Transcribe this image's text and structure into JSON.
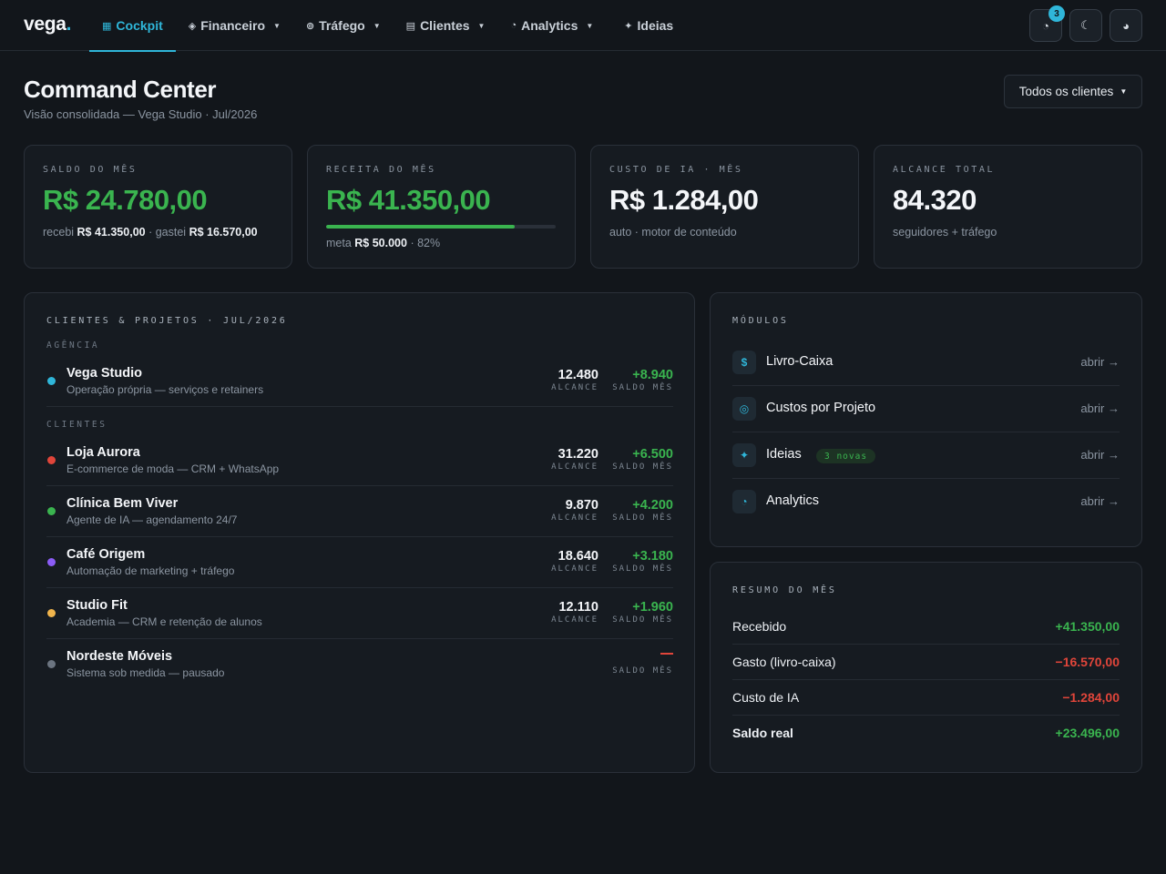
{
  "brand": {
    "name": "vega",
    "dot": "."
  },
  "nav": [
    {
      "icon": "▦",
      "label": "Cockpit",
      "caret": "",
      "active": true
    },
    {
      "icon": "◈",
      "label": "Financeiro",
      "caret": "▼"
    },
    {
      "icon": "⊚",
      "label": "Tráfego",
      "caret": "▼"
    },
    {
      "icon": "▤",
      "label": "Clientes",
      "caret": "▼"
    },
    {
      "icon": "◔",
      "label": "Analytics",
      "caret": "▼"
    },
    {
      "icon": "✦",
      "label": "Ideias",
      "caret": ""
    }
  ],
  "toolbar": {
    "notifications_icon": "◔",
    "notifications_count": "3",
    "theme_icon": "☾",
    "contrast_icon": "◕"
  },
  "header": {
    "title": "Command Center",
    "subtitle": "Visão consolidada — Vega Studio · Jul/2026",
    "client_filter": "Todos os clientes",
    "client_filter_caret": "▼"
  },
  "stats": {
    "saldo": {
      "label": "Saldo do mês",
      "value": "R$ 24.780,00",
      "foot_a": "recebi",
      "foot_a_val": "R$ 41.350,00",
      "foot_b": "· gastei",
      "foot_b_val": "R$ 16.570,00"
    },
    "receita": {
      "label": "Receita do mês",
      "value": "R$ 41.350,00",
      "progress_percent": 82,
      "foot_a": "meta",
      "foot_a_val": "R$ 50.000",
      "foot_b": "· 82%"
    },
    "custo_ia": {
      "label": "Custo de IA · mês",
      "value": "R$ 1.284,00",
      "foot": "auto · motor de conteúdo"
    },
    "alcance": {
      "label": "Alcance total",
      "value": "84.320",
      "foot": "seguidores + tráfego"
    }
  },
  "clients_panel": {
    "title": "Clientes & Projetos · Jul/2026",
    "agency_label": "Agência",
    "clients_label": "Clientes",
    "reach_caption": "Alcance",
    "saldo_caption": "Saldo mês",
    "agency": {
      "name": "Vega Studio",
      "desc": "Operação própria — serviços e retainers",
      "reach": "12.480",
      "saldo": "+8.940",
      "color": "#2fb6d9"
    },
    "clients": [
      {
        "name": "Loja Aurora",
        "desc": "E-commerce de moda — CRM + WhatsApp",
        "reach": "31.220",
        "saldo": "+6.500",
        "color": "#e0453a"
      },
      {
        "name": "Clínica Bem Viver",
        "desc": "Agente de IA — agendamento 24/7",
        "reach": "9.870",
        "saldo": "+4.200",
        "color": "#3ab44f"
      },
      {
        "name": "Café Origem",
        "desc": "Automação de marketing + tráfego",
        "reach": "18.640",
        "saldo": "+3.180",
        "color": "#8b5cf6"
      },
      {
        "name": "Studio Fit",
        "desc": "Academia — CRM e retenção de alunos",
        "reach": "12.110",
        "saldo": "+1.960",
        "color": "#f0b44c"
      },
      {
        "name": "Nordeste Móveis",
        "desc": "Sistema sob medida — pausado",
        "reach": "",
        "saldo": "",
        "color": "#6b7480"
      }
    ]
  },
  "modules_panel": {
    "title": "Módulos",
    "open_label": "abrir →",
    "items": [
      {
        "icon": "$",
        "name": "Livro-Caixa",
        "badge": ""
      },
      {
        "icon": "◎",
        "name": "Custos por Projeto",
        "badge": ""
      },
      {
        "icon": "✦",
        "name": "Ideias",
        "badge": "3 novas"
      },
      {
        "icon": "◔",
        "name": "Analytics",
        "badge": ""
      }
    ]
  },
  "summary_panel": {
    "title": "Resumo do mês",
    "rows": [
      {
        "label": "Recebido",
        "value": "+41.350,00",
        "tone": "pos"
      },
      {
        "label": "Gasto (livro-caixa)",
        "value": "−16.570,00",
        "tone": "neg"
      },
      {
        "label": "Custo de IA",
        "value": "−1.284,00",
        "tone": "neg"
      },
      {
        "label": "Saldo real",
        "value": "+23.496,00",
        "tone": "pos",
        "bold": true
      }
    ]
  },
  "colors": {
    "accent": "#2fb6d9",
    "positive": "#3ab44f",
    "negative": "#e0453a",
    "background": "#12161b",
    "card": "#161b21"
  }
}
